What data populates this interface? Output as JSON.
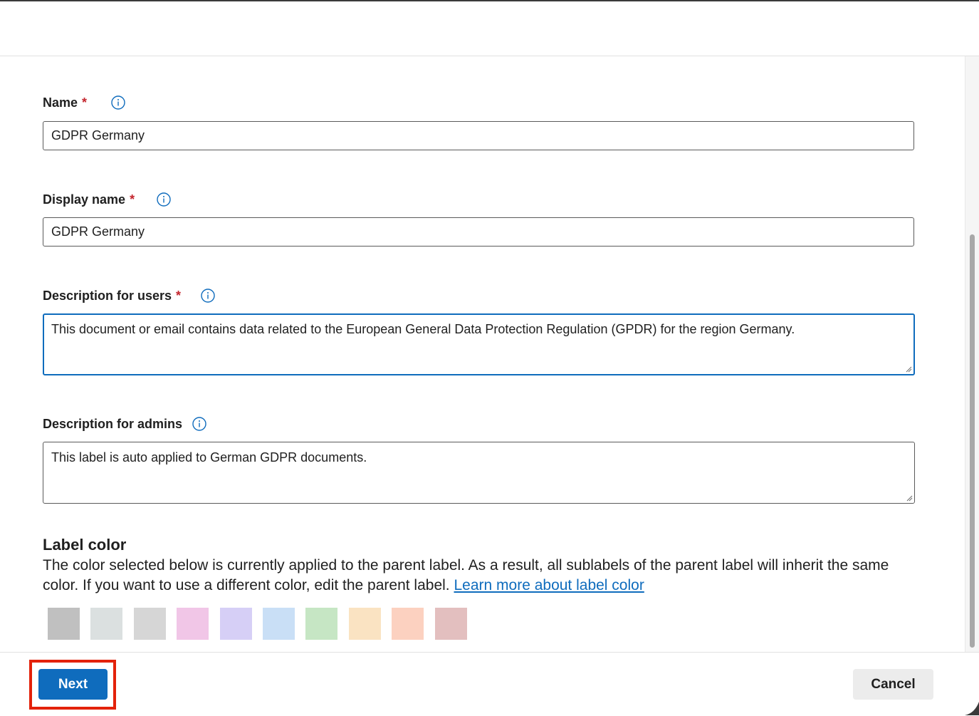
{
  "form": {
    "name": {
      "label": "Name",
      "required_marker": "*",
      "value": "GDPR Germany"
    },
    "display_name": {
      "label": "Display name",
      "required_marker": "*",
      "value": "GDPR Germany"
    },
    "description_users": {
      "label": "Description for users",
      "required_marker": "*",
      "value": "This document or email contains data related to the European General Data Protection Regulation (GPDR) for the region Germany."
    },
    "description_admins": {
      "label": "Description for admins",
      "value": "This label is auto applied to German GDPR documents."
    }
  },
  "label_color": {
    "title": "Label color",
    "description": "The color selected below is currently applied to the parent label. As a result, all sublabels of the parent label will inherit the same color. If you want to use a different color, edit the parent label.",
    "link_text": "Learn more about label color",
    "swatches": [
      "#c0c0c0",
      "#dbe0e0",
      "#d6d6d6",
      "#f1c6e7",
      "#d6cff6",
      "#c9dff6",
      "#c6e6c4",
      "#fae3c2",
      "#fcd1c0",
      "#e3bfbf"
    ]
  },
  "footer": {
    "next_label": "Next",
    "cancel_label": "Cancel"
  },
  "colors": {
    "accent": "#0f6cbd",
    "required": "#c4262e",
    "highlight": "#e3220a"
  },
  "icons": {
    "info": "info-circle-icon"
  }
}
